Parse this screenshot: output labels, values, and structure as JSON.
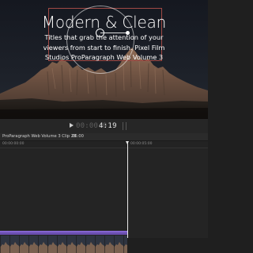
{
  "viewer": {
    "title": "Modern & Clean",
    "body_lines": [
      "Titles that grab the attention of your",
      "viewers from start to finish. Pixel Film",
      "Studios ProParagraph Web Volume 3"
    ]
  },
  "transport": {
    "timecode_dim": "00:00:0",
    "timecode_bright": "4:19"
  },
  "timeline": {
    "project_name": "ProParagraph Web Volume 3 Clip 28",
    "project_duration": "06:00",
    "ruler_labels": [
      "00:00:00:00",
      "00:00:05:00"
    ]
  },
  "colors": {
    "accent_box": "#a04a45",
    "title_clip": "#6a4fb0",
    "viewer_sky": "#1a1d24"
  }
}
